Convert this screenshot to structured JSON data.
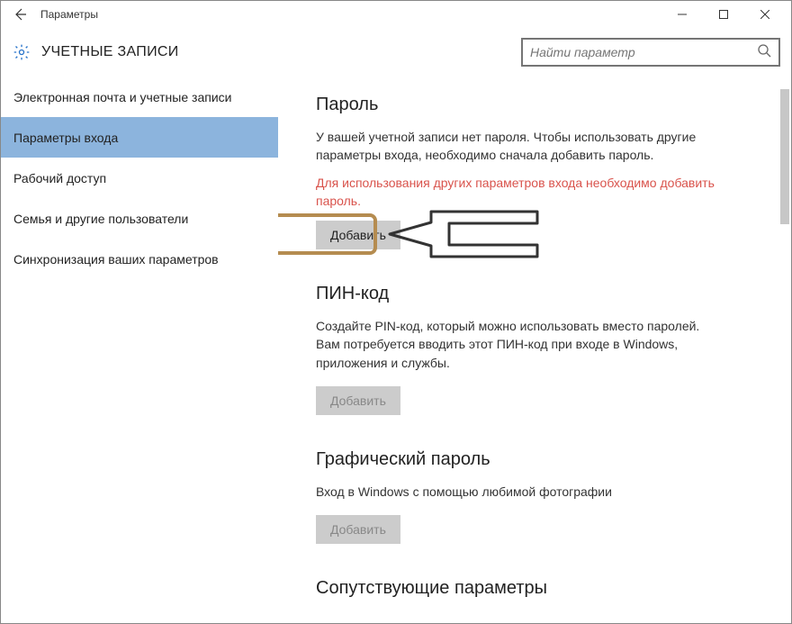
{
  "window": {
    "title": "Параметры"
  },
  "header": {
    "title": "УЧЕТНЫЕ ЗАПИСИ"
  },
  "search": {
    "placeholder": "Найти параметр"
  },
  "sidebar": {
    "items": [
      {
        "label": "Электронная почта и учетные записи"
      },
      {
        "label": "Параметры входа"
      },
      {
        "label": "Рабочий доступ"
      },
      {
        "label": "Семья и другие пользователи"
      },
      {
        "label": "Синхронизация ваших параметров"
      }
    ],
    "active_index": 1
  },
  "content": {
    "password": {
      "heading": "Пароль",
      "desc": "У вашей учетной записи нет пароля. Чтобы использовать другие параметры входа, необходимо сначала добавить пароль.",
      "warning": "Для использования других параметров входа необходимо добавить пароль.",
      "button": "Добавить"
    },
    "pin": {
      "heading": "ПИН-код",
      "desc": "Создайте PIN-код, который можно использовать вместо паролей. Вам потребуется вводить этот ПИН-код при входе в Windows, приложения и службы.",
      "button": "Добавить"
    },
    "picture": {
      "heading": "Графический пароль",
      "desc": "Вход в Windows с помощью любимой фотографии",
      "button": "Добавить"
    },
    "related": {
      "heading": "Сопутствующие параметры"
    }
  }
}
